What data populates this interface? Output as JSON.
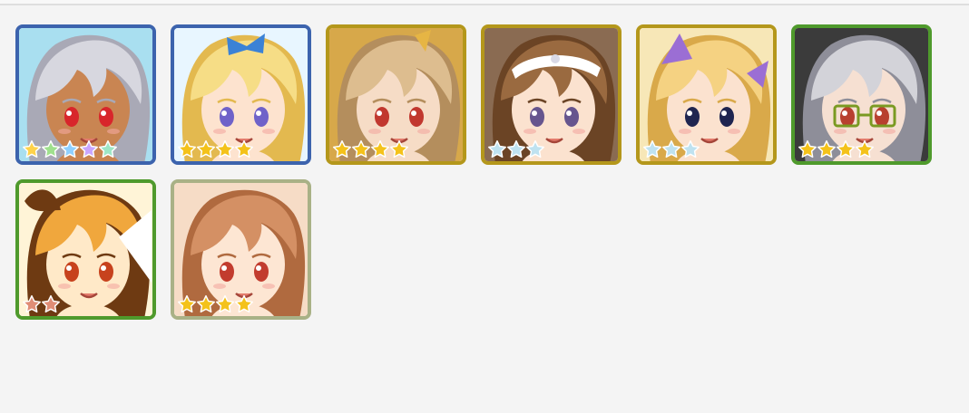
{
  "border_colors": {
    "blue": "#3c63ad",
    "gold": "#b4971b",
    "green": "#4f9a2c",
    "khaki": "#a9b186"
  },
  "star_colors": {
    "rainbow": [
      "#ffd24a",
      "#9fe08d",
      "#8fd0ff",
      "#c9a6ff",
      "#9ee6c6"
    ],
    "gold": "#f4c21a",
    "silver": "#bfe2f0",
    "bronze": "#e08d76"
  },
  "characters": [
    {
      "icon": "character-portrait-icon",
      "frame": "blue",
      "stars": 5,
      "star_style": "rainbow",
      "hair": "#d7d7df",
      "hair_dark": "#a9a9b6",
      "skin": "#c98552",
      "eye": "#d8262b",
      "bg": "#a9dff0",
      "accessory": "none"
    },
    {
      "icon": "character-portrait-icon",
      "frame": "blue",
      "stars": 4,
      "star_style": "gold",
      "hair": "#f6dd86",
      "hair_dark": "#e3b94f",
      "skin": "#fde3cf",
      "eye": "#6f62c9",
      "bg": "#e8f6ff",
      "accessory": "bow"
    },
    {
      "icon": "character-portrait-icon",
      "frame": "gold",
      "stars": 4,
      "star_style": "gold",
      "hair": "#ddbd8f",
      "hair_dark": "#b48e5d",
      "skin": "#f6dcc6",
      "eye": "#c1382f",
      "bg": "#d7a84a",
      "accessory": "horn"
    },
    {
      "icon": "character-portrait-icon",
      "frame": "gold",
      "stars": 3,
      "star_style": "silver",
      "hair": "#9a6a40",
      "hair_dark": "#6b4425",
      "skin": "#fbe2cf",
      "eye": "#66558e",
      "bg": "#8a6b52",
      "accessory": "headband"
    },
    {
      "icon": "character-portrait-icon",
      "frame": "gold",
      "stars": 3,
      "star_style": "silver",
      "hair": "#f5d282",
      "hair_dark": "#d9a94a",
      "skin": "#fbe2cf",
      "eye": "#1f2550",
      "bg": "#f7e7b7",
      "accessory": "ears"
    },
    {
      "icon": "character-portrait-icon",
      "frame": "green",
      "stars": 4,
      "star_style": "gold",
      "hair": "#d3d3d9",
      "hair_dark": "#8e8e99",
      "skin": "#f6e0d2",
      "eye": "#b8402f",
      "bg": "#3b3b3b",
      "accessory": "glasses"
    },
    {
      "icon": "character-portrait-icon",
      "frame": "green",
      "stars": 2,
      "star_style": "bronze",
      "hair": "#f0a73d",
      "hair_dark": "#6e3a12",
      "skin": "#ffe9c8",
      "eye": "#c7421d",
      "bg": "#fff4d7",
      "accessory": "fox"
    },
    {
      "icon": "character-portrait-icon",
      "frame": "khaki",
      "stars": 4,
      "star_style": "gold",
      "hair": "#d49064",
      "hair_dark": "#b06a3f",
      "skin": "#fde6d3",
      "eye": "#c23c2e",
      "bg": "#f6dcc6",
      "accessory": "none"
    }
  ]
}
